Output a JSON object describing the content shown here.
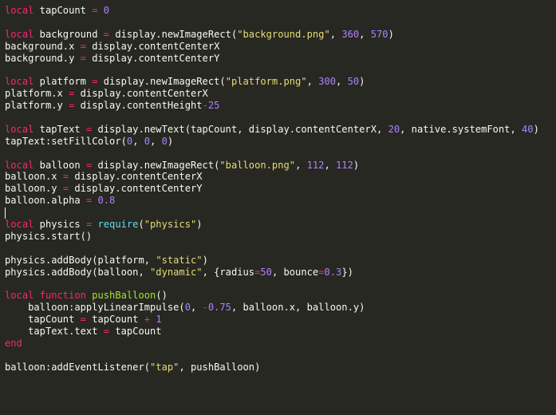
{
  "editor": {
    "colors": {
      "background": "#272822",
      "text": "#f8f8f2",
      "keyword": "#f92672",
      "builtin": "#66d9ef",
      "string": "#e6db74",
      "number": "#ae81ff",
      "function": "#a6e22e",
      "cursor": "#f8f8f0"
    },
    "cursor_line": 17,
    "lines": [
      [
        [
          "keyword",
          "local"
        ],
        [
          "text",
          " tapCount "
        ],
        [
          "op",
          "="
        ],
        [
          "text",
          " "
        ],
        [
          "number",
          "0"
        ]
      ],
      [],
      [
        [
          "keyword",
          "local"
        ],
        [
          "text",
          " background "
        ],
        [
          "op",
          "="
        ],
        [
          "text",
          " display.newImageRect("
        ],
        [
          "string",
          "\"background.png\""
        ],
        [
          "text",
          ", "
        ],
        [
          "number",
          "360"
        ],
        [
          "text",
          ", "
        ],
        [
          "number",
          "570"
        ],
        [
          "text",
          ")"
        ]
      ],
      [
        [
          "text",
          "background.x "
        ],
        [
          "op",
          "="
        ],
        [
          "text",
          " display.contentCenterX"
        ]
      ],
      [
        [
          "text",
          "background.y "
        ],
        [
          "op",
          "="
        ],
        [
          "text",
          " display.contentCenterY"
        ]
      ],
      [],
      [
        [
          "keyword",
          "local"
        ],
        [
          "text",
          " platform "
        ],
        [
          "op",
          "="
        ],
        [
          "text",
          " display.newImageRect("
        ],
        [
          "string",
          "\"platform.png\""
        ],
        [
          "text",
          ", "
        ],
        [
          "number",
          "300"
        ],
        [
          "text",
          ", "
        ],
        [
          "number",
          "50"
        ],
        [
          "text",
          ")"
        ]
      ],
      [
        [
          "text",
          "platform.x "
        ],
        [
          "op",
          "="
        ],
        [
          "text",
          " display.contentCenterX"
        ]
      ],
      [
        [
          "text",
          "platform.y "
        ],
        [
          "op",
          "="
        ],
        [
          "text",
          " display.contentHeight"
        ],
        [
          "op",
          "-"
        ],
        [
          "number",
          "25"
        ]
      ],
      [],
      [
        [
          "keyword",
          "local"
        ],
        [
          "text",
          " tapText "
        ],
        [
          "op",
          "="
        ],
        [
          "text",
          " display.newText(tapCount, display.contentCenterX, "
        ],
        [
          "number",
          "20"
        ],
        [
          "text",
          ", native.systemFont, "
        ],
        [
          "number",
          "40"
        ],
        [
          "text",
          ")"
        ]
      ],
      [
        [
          "text",
          "tapText:setFillColor("
        ],
        [
          "number",
          "0"
        ],
        [
          "text",
          ", "
        ],
        [
          "number",
          "0"
        ],
        [
          "text",
          ", "
        ],
        [
          "number",
          "0"
        ],
        [
          "text",
          ")"
        ]
      ],
      [],
      [
        [
          "keyword",
          "local"
        ],
        [
          "text",
          " balloon "
        ],
        [
          "op",
          "="
        ],
        [
          "text",
          " display.newImageRect("
        ],
        [
          "string",
          "\"balloon.png\""
        ],
        [
          "text",
          ", "
        ],
        [
          "number",
          "112"
        ],
        [
          "text",
          ", "
        ],
        [
          "number",
          "112"
        ],
        [
          "text",
          ")"
        ]
      ],
      [
        [
          "text",
          "balloon.x "
        ],
        [
          "op",
          "="
        ],
        [
          "text",
          " display.contentCenterX"
        ]
      ],
      [
        [
          "text",
          "balloon.y "
        ],
        [
          "op",
          "="
        ],
        [
          "text",
          " display.contentCenterY"
        ]
      ],
      [
        [
          "text",
          "balloon.alpha "
        ],
        [
          "op",
          "="
        ],
        [
          "text",
          " "
        ],
        [
          "number",
          "0.8"
        ]
      ],
      [],
      [
        [
          "keyword",
          "local"
        ],
        [
          "text",
          " physics "
        ],
        [
          "op",
          "="
        ],
        [
          "text",
          " "
        ],
        [
          "builtin",
          "require"
        ],
        [
          "text",
          "("
        ],
        [
          "string",
          "\"physics\""
        ],
        [
          "text",
          ")"
        ]
      ],
      [
        [
          "text",
          "physics.start()"
        ]
      ],
      [],
      [
        [
          "text",
          "physics.addBody(platform, "
        ],
        [
          "string",
          "\"static\""
        ],
        [
          "text",
          ")"
        ]
      ],
      [
        [
          "text",
          "physics.addBody(balloon, "
        ],
        [
          "string",
          "\"dynamic\""
        ],
        [
          "text",
          ", {radius"
        ],
        [
          "op",
          "="
        ],
        [
          "number",
          "50"
        ],
        [
          "text",
          ", bounce"
        ],
        [
          "op",
          "="
        ],
        [
          "number",
          "0.3"
        ],
        [
          "text",
          "})"
        ]
      ],
      [],
      [
        [
          "keyword",
          "local"
        ],
        [
          "text",
          " "
        ],
        [
          "keyword",
          "function"
        ],
        [
          "text",
          " "
        ],
        [
          "func",
          "pushBalloon"
        ],
        [
          "text",
          "()"
        ]
      ],
      [
        [
          "text",
          "    balloon:applyLinearImpulse("
        ],
        [
          "number",
          "0"
        ],
        [
          "text",
          ", "
        ],
        [
          "op",
          "-"
        ],
        [
          "number",
          "0.75"
        ],
        [
          "text",
          ", balloon.x, balloon.y)"
        ]
      ],
      [
        [
          "text",
          "    tapCount "
        ],
        [
          "op",
          "="
        ],
        [
          "text",
          " tapCount "
        ],
        [
          "op",
          "+"
        ],
        [
          "text",
          " "
        ],
        [
          "number",
          "1"
        ]
      ],
      [
        [
          "text",
          "    tapText.text "
        ],
        [
          "op",
          "="
        ],
        [
          "text",
          " tapCount"
        ]
      ],
      [
        [
          "keyword",
          "end"
        ]
      ],
      [],
      [
        [
          "text",
          "balloon:addEventListener("
        ],
        [
          "string",
          "\"tap\""
        ],
        [
          "text",
          ", pushBalloon)"
        ]
      ]
    ]
  }
}
